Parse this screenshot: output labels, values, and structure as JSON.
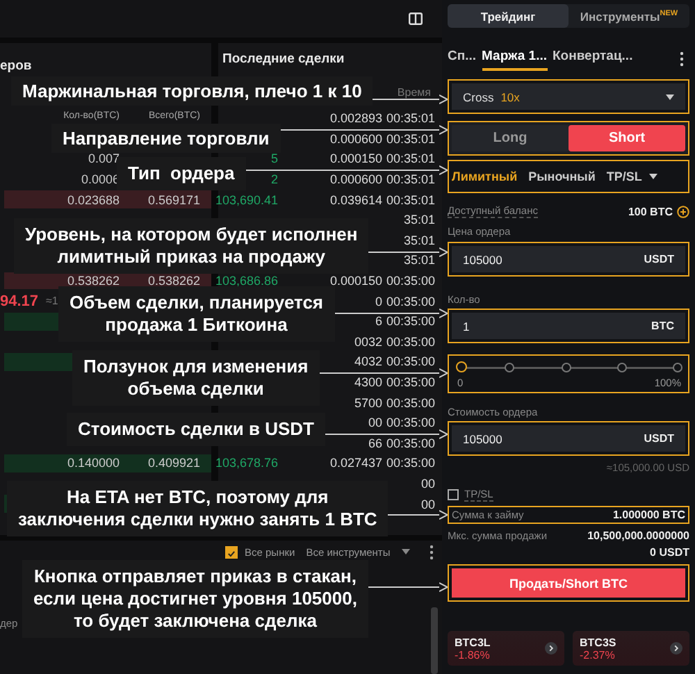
{
  "order_book": {
    "title": "еров",
    "columns": [
      "Кол-во(BTC)",
      "Всего(BTC)"
    ],
    "rows": [
      {},
      {
        "amount": "0.007"
      },
      {
        "amount": "0.0006"
      },
      {
        "color": "#3a1d21",
        "amount": "0.023688",
        "total": "0.569171"
      },
      {},
      {},
      {},
      {
        "color": "#3a1d21",
        "amount": "0.538262",
        "total": "0.538262"
      },
      {
        "price": "94.17",
        "approx": "≈1"
      },
      {
        "color": "#12301f"
      },
      {},
      {
        "color": "#12301f"
      },
      {},
      {},
      {},
      {},
      {
        "color": "#12301f",
        "amount": "0.140000",
        "total": "0.409921"
      },
      {},
      {
        "color": "#12301f"
      },
      {}
    ]
  },
  "trades": {
    "title": "Последние сделки",
    "time_header": "Время",
    "rows": [
      {
        "amount": "0.002893",
        "time": "00:35:01"
      },
      {
        "amount": "0.000600",
        "time": "00:35:01"
      },
      {
        "price": "5",
        "amount": "0.000150",
        "time": "00:35:01"
      },
      {
        "price": "2",
        "amount": "0.000600",
        "time": "00:35:01"
      },
      {
        "price": "103,690.41",
        "amount": "0.039614",
        "time": "00:35:01"
      },
      {
        "time": "35:01"
      },
      {
        "time": "35:01"
      },
      {
        "time": "35:01"
      },
      {
        "price": "103,686.86",
        "amount": "0.000150",
        "time": "00:35:00"
      },
      {
        "amount": "0",
        "time": "00:35:00"
      },
      {
        "amount": "6",
        "time": "00:35:00"
      },
      {
        "amount": "0032",
        "time": "00:35:00"
      },
      {
        "amount": "4032",
        "time": "00:35:00"
      },
      {
        "amount": "4300",
        "time": "00:35:00"
      },
      {
        "amount": "5700",
        "time": "00:35:00"
      },
      {
        "amount": "00",
        "time": "00:35:00"
      },
      {
        "amount": "66",
        "time": "00:35:00"
      },
      {
        "price": "103,678.76",
        "amount": "0.027437",
        "time": "00:35:00"
      },
      {
        "time": "00"
      },
      {
        "time": "00"
      }
    ]
  },
  "filters": {
    "all_markets": {
      "label": "Все рынки",
      "checked": true
    },
    "instruments": "Все инструменты",
    "input_fragment": "дер"
  },
  "annotations": [
    {
      "text": "Маржинальная торговля, плечо 1 к 10"
    },
    {
      "text": "Направление торговли"
    },
    {
      "text": "Тип  ордера"
    },
    {
      "text": "Уровень, на котором будет исполнен\nлимитный приказ на продажу"
    },
    {
      "text": "Объем сделки, планируется\nпродажа 1 Биткоина"
    },
    {
      "text": "Ползунок для изменения\nобъема сделки"
    },
    {
      "text": "Стоимость сделки в USDT"
    },
    {
      "text": "На ETA нет BTC, поэтому для\nзаключения сделки нужно занять 1 BTC"
    },
    {
      "text": "Кнопка отправляет приказ в стакан,\nесли цена достигнет уровня 105000,\nто будет заключена сделка"
    }
  ],
  "panel": {
    "mode_tabs": [
      {
        "label": "Трейдинг",
        "selected": true
      },
      {
        "label": "Инструменты",
        "badge": "NEW",
        "selected": false
      }
    ],
    "market_tabs": [
      {
        "label": "Сп...",
        "selected": false
      },
      {
        "label": "Маржа 1...",
        "selected": true
      },
      {
        "label": "Конвертац...",
        "selected": false
      }
    ],
    "margin_mode": {
      "mode": "Cross",
      "leverage": "10x"
    },
    "sides": [
      {
        "label": "Long",
        "selected": false
      },
      {
        "label": "Short",
        "selected": true
      }
    ],
    "order_types": [
      {
        "label": "Лимитный",
        "selected": true,
        "dropdown": false
      },
      {
        "label": "Рыночный",
        "selected": false,
        "dropdown": false
      },
      {
        "label": "TP/SL",
        "selected": false,
        "dropdown": true
      }
    ],
    "balance": {
      "label": "Доступный баланс",
      "value": "100 BTC"
    },
    "price": {
      "label": "Цена ордера",
      "value": "105000",
      "unit": "USDT"
    },
    "amount": {
      "label": "Кол-во",
      "value": "1",
      "unit": "BTC"
    },
    "slider": {
      "level": 0,
      "min_label": "0",
      "max_label": "100%"
    },
    "total": {
      "label": "Стоимость ордера",
      "value": "105000",
      "unit": "USDT"
    },
    "total_approx": "≈105,000.00 USD",
    "tpsl": {
      "label": "TP/SL",
      "checked": false
    },
    "borrow": {
      "label": "Сумма к займу",
      "value": "1.000000 BTC"
    },
    "max_sell": {
      "label": "Мкс. сумма продажи",
      "values": [
        "10,500,000.0000000",
        "0 USDT"
      ]
    },
    "submit": "Продать/Short BTC",
    "tokens": [
      {
        "name": "BTC3L",
        "change": "-1.86%"
      },
      {
        "name": "BTC3S",
        "change": "-2.37%"
      }
    ]
  }
}
